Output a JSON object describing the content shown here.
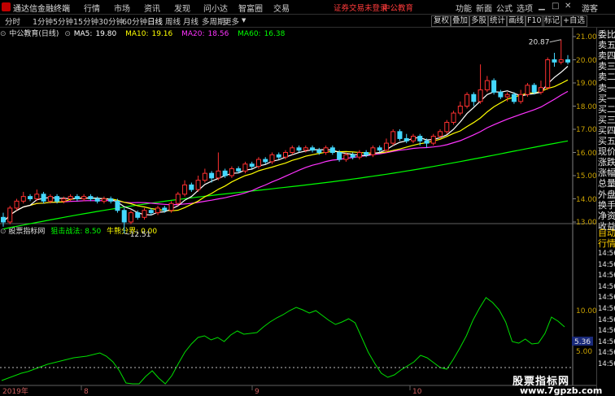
{
  "app": {
    "name": "通达信金融终端"
  },
  "menu": {
    "items": [
      "行情",
      "市场",
      "资讯",
      "发现",
      "问小达",
      "智富圈",
      "交易"
    ]
  },
  "status": {
    "login_warning": "证券交易未登录",
    "stock_name": "中公教育"
  },
  "window_controls": {
    "items": [
      "功能",
      "新面",
      "公式",
      "选项"
    ],
    "guest": "游客"
  },
  "periods": {
    "items": [
      "分时",
      "1分钟",
      "5分钟",
      "15分钟",
      "30分钟",
      "60分钟",
      "日线",
      "周线",
      "月线",
      "多周期",
      "更多"
    ],
    "active": "日线"
  },
  "tools": {
    "items": [
      "复权",
      "叠加",
      "多股",
      "统计",
      "画线",
      "F10",
      "标记",
      "+自选"
    ]
  },
  "main_legend": {
    "title": "中公教育(日线)",
    "ma5": {
      "label": "MA5:",
      "value": "19.80",
      "color": "#ffffff"
    },
    "ma10": {
      "label": "MA10:",
      "value": "19.16",
      "color": "#ffff00"
    },
    "ma20": {
      "label": "MA20:",
      "value": "18.56",
      "color": "#ff33ff"
    },
    "ma60": {
      "label": "MA60:",
      "value": "16.38",
      "color": "#00ff00"
    }
  },
  "price_axis": [
    "21.00",
    "20.00",
    "19.00",
    "18.00",
    "17.00",
    "16.00",
    "15.00",
    "14.00",
    "13.00"
  ],
  "annotations": {
    "high": "20.87",
    "low": "12.51"
  },
  "indicator": {
    "name": "股票指标网",
    "line1_label": "狙击战法:",
    "line1_value": "8.50",
    "line2_label": "牛熊分界:",
    "line2_value": "0.00"
  },
  "indicator_axis": {
    "v1": "10.00",
    "v2": "5.36",
    "v3": "5.00"
  },
  "date_axis": {
    "year": "2019年",
    "m8": "8",
    "m9": "9",
    "m10": "10"
  },
  "right_panel": {
    "labels": [
      "委比",
      "卖五",
      "卖四",
      "卖三",
      "卖二",
      "卖一",
      "买一",
      "买二",
      "买三",
      "买四",
      "买五",
      "现价",
      "涨跌",
      "涨幅",
      "总量",
      "外盘",
      "换手",
      "净资",
      "收益"
    ],
    "lower_labels": [
      "自动",
      "行情"
    ],
    "times": [
      "14:56",
      "14:56",
      "14:56",
      "14:56",
      "14:56",
      "14:56",
      "14:56",
      "14:56",
      "14:56",
      "14:56",
      "14:56"
    ]
  },
  "watermark": {
    "line1": "股票指标网",
    "line2": "www.7gpzb.com"
  },
  "chart_data": {
    "type": "candlestick",
    "price_range": [
      12.5,
      21.3
    ],
    "candles": [
      [
        13.2,
        13.0,
        13.4,
        12.8
      ],
      [
        13.0,
        13.6,
        13.7,
        12.9
      ],
      [
        13.6,
        13.9,
        14.0,
        13.5
      ],
      [
        13.9,
        14.1,
        14.3,
        13.8
      ],
      [
        14.1,
        14.0,
        14.2,
        13.9
      ],
      [
        14.0,
        14.2,
        14.4,
        13.9
      ],
      [
        14.2,
        13.9,
        14.3,
        13.8
      ],
      [
        13.9,
        14.1,
        14.2,
        13.8
      ],
      [
        14.1,
        13.9,
        14.2,
        13.8
      ],
      [
        13.9,
        14.0,
        14.1,
        13.8
      ],
      [
        14.0,
        14.1,
        14.2,
        13.9
      ],
      [
        14.1,
        14.0,
        14.2,
        13.9
      ],
      [
        14.0,
        14.1,
        14.2,
        13.9
      ],
      [
        14.1,
        14.0,
        14.2,
        13.9
      ],
      [
        14.0,
        13.9,
        14.1,
        13.8
      ],
      [
        13.9,
        14.0,
        14.1,
        13.8
      ],
      [
        14.0,
        13.9,
        14.1,
        13.8
      ],
      [
        13.9,
        13.5,
        14.0,
        13.4
      ],
      [
        13.5,
        13.0,
        13.6,
        12.51
      ],
      [
        13.0,
        13.4,
        13.5,
        12.9
      ],
      [
        13.4,
        13.2,
        13.5,
        13.1
      ],
      [
        13.2,
        13.5,
        13.6,
        13.1
      ],
      [
        13.5,
        13.4,
        13.6,
        13.3
      ],
      [
        13.4,
        13.6,
        13.7,
        13.3
      ],
      [
        13.6,
        13.5,
        13.7,
        13.4
      ],
      [
        13.5,
        13.8,
        13.9,
        13.4
      ],
      [
        13.8,
        14.2,
        14.3,
        13.7
      ],
      [
        14.2,
        14.6,
        14.8,
        14.1
      ],
      [
        14.6,
        14.4,
        14.7,
        14.3
      ],
      [
        14.4,
        14.8,
        15.0,
        14.3
      ],
      [
        14.8,
        15.1,
        15.3,
        14.7
      ],
      [
        15.1,
        14.9,
        15.2,
        14.7
      ],
      [
        14.9,
        15.2,
        16.0,
        14.8
      ],
      [
        15.2,
        15.0,
        15.3,
        14.9
      ],
      [
        15.0,
        15.3,
        15.4,
        14.9
      ],
      [
        15.3,
        15.2,
        15.4,
        15.1
      ],
      [
        15.2,
        15.5,
        15.6,
        15.1
      ],
      [
        15.5,
        15.4,
        15.6,
        15.3
      ],
      [
        15.4,
        15.7,
        15.8,
        15.3
      ],
      [
        15.7,
        15.6,
        15.8,
        15.5
      ],
      [
        15.6,
        15.9,
        16.0,
        15.5
      ],
      [
        15.9,
        15.8,
        16.0,
        15.7
      ],
      [
        15.8,
        16.0,
        16.1,
        15.7
      ],
      [
        16.0,
        16.2,
        16.3,
        15.9
      ],
      [
        16.2,
        16.1,
        16.3,
        16.0
      ],
      [
        16.1,
        16.2,
        16.3,
        16.0
      ],
      [
        16.2,
        16.1,
        16.3,
        16.0
      ],
      [
        16.1,
        16.0,
        16.2,
        15.9
      ],
      [
        16.0,
        16.2,
        16.3,
        15.9
      ],
      [
        16.2,
        16.0,
        16.3,
        15.9
      ],
      [
        16.0,
        15.7,
        16.1,
        15.6
      ],
      [
        15.7,
        15.9,
        16.0,
        15.6
      ],
      [
        15.9,
        15.8,
        16.0,
        15.7
      ],
      [
        15.8,
        16.0,
        16.1,
        15.7
      ],
      [
        16.0,
        15.9,
        16.1,
        15.8
      ],
      [
        15.9,
        16.2,
        16.3,
        15.8
      ],
      [
        16.2,
        16.1,
        16.3,
        16.0
      ],
      [
        16.1,
        16.4,
        16.6,
        16.0
      ],
      [
        16.4,
        16.9,
        17.0,
        16.3
      ],
      [
        16.9,
        16.6,
        17.0,
        16.5
      ],
      [
        16.6,
        16.5,
        16.8,
        16.4
      ],
      [
        16.5,
        16.7,
        16.8,
        16.4
      ],
      [
        16.7,
        16.5,
        16.8,
        16.3
      ],
      [
        16.5,
        16.4,
        16.6,
        16.2
      ],
      [
        16.4,
        16.7,
        16.8,
        16.3
      ],
      [
        16.7,
        16.9,
        17.0,
        16.6
      ],
      [
        16.9,
        17.3,
        17.4,
        16.8
      ],
      [
        17.3,
        17.7,
        17.8,
        17.2
      ],
      [
        17.7,
        18.0,
        18.2,
        17.6
      ],
      [
        18.0,
        18.5,
        18.6,
        17.9
      ],
      [
        18.5,
        18.2,
        18.6,
        18.0
      ],
      [
        18.2,
        18.7,
        19.8,
        18.1
      ],
      [
        18.7,
        19.1,
        19.3,
        18.6
      ],
      [
        19.1,
        18.6,
        19.2,
        18.5
      ],
      [
        18.6,
        18.4,
        18.7,
        18.3
      ],
      [
        18.4,
        18.5,
        18.6,
        18.2
      ],
      [
        18.5,
        18.2,
        18.6,
        18.1
      ],
      [
        18.2,
        18.5,
        18.7,
        18.1
      ],
      [
        18.5,
        18.9,
        19.0,
        18.4
      ],
      [
        18.9,
        18.6,
        19.0,
        18.5
      ],
      [
        18.6,
        18.8,
        19.1,
        18.5
      ],
      [
        18.8,
        20.0,
        20.1,
        18.7
      ],
      [
        20.0,
        19.9,
        20.3,
        19.7
      ],
      [
        19.9,
        20.0,
        20.87,
        19.8
      ],
      [
        20.0,
        19.9,
        20.2,
        19.8
      ]
    ],
    "indicator_series": [
      1.3,
      1.6,
      1.9,
      2.2,
      2.4,
      2.7,
      3.0,
      3.3,
      3.5,
      3.7,
      3.9,
      4.1,
      4.2,
      4.3,
      4.5,
      4.7,
      4.3,
      3.6,
      2.5,
      1.0,
      -0.5,
      0.6,
      1.8,
      2.5,
      1.6,
      0.8,
      1.9,
      3.4,
      4.8,
      5.8,
      6.6,
      6.8,
      6.3,
      6.6,
      6.1,
      6.9,
      7.4,
      7.0,
      7.1,
      7.2,
      7.9,
      8.5,
      9.0,
      9.4,
      9.9,
      10.3,
      10.0,
      9.6,
      9.9,
      9.3,
      8.7,
      8.2,
      8.5,
      8.9,
      8.4,
      6.6,
      4.8,
      3.4,
      2.2,
      1.7,
      2.0,
      2.6,
      3.1,
      3.6,
      4.4,
      4.1,
      3.5,
      2.9,
      2.7,
      3.9,
      5.3,
      6.8,
      8.7,
      10.2,
      11.5,
      10.9,
      10.0,
      8.5,
      6.1,
      5.9,
      6.4,
      5.8,
      5.9,
      7.1,
      9.1,
      8.6,
      7.9
    ]
  }
}
